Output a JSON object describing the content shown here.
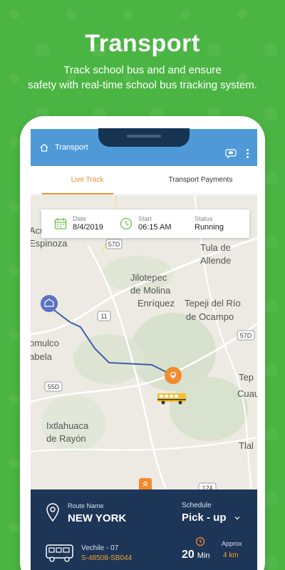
{
  "hero": {
    "title": "Transport",
    "subtitle_line1": "Track school bus and and ensure",
    "subtitle_line2": "safety with real-time school bus tracking system."
  },
  "appbar": {
    "title": "Transport",
    "icons": [
      "home-icon",
      "bus-chat-icon",
      "more-vertical-icon"
    ]
  },
  "tabs": [
    {
      "label": "Live Track",
      "active": true
    },
    {
      "label": "Transport Payments",
      "active": false
    }
  ],
  "trip_info": {
    "date_label": "Date",
    "date_value": "8/4/2019",
    "start_label": "Start",
    "start_value": "06:15 AM",
    "status_label": "Status",
    "status_value": "Running"
  },
  "map": {
    "places": [
      "Acu",
      "Espinoza",
      "Tula de",
      "Allende",
      "Jilotepec",
      "de Molina",
      "Enríquez",
      "Tepeji del Río",
      "de Ocampo",
      "omulco",
      "abela",
      "Ixtlahuaca",
      "de Rayón",
      "Tep",
      "Cuau",
      "Tlal"
    ],
    "highway_labels": [
      "57D",
      "11",
      "57D",
      "55D",
      "124"
    ],
    "accent": "#f28a2e",
    "route_color": "#3e5ea8"
  },
  "panel": {
    "route_label": "Route Name",
    "route_value": "NEW YORK",
    "schedule_label": "Schedule",
    "schedule_value": "Pick - up",
    "vehicle_label": "Vechile - 07",
    "vehicle_id": "S-48508-SB044",
    "eta_value": "20",
    "eta_unit": "Min",
    "approx_label": "Approx",
    "approx_value": "4 km",
    "background": "#1d3557"
  }
}
